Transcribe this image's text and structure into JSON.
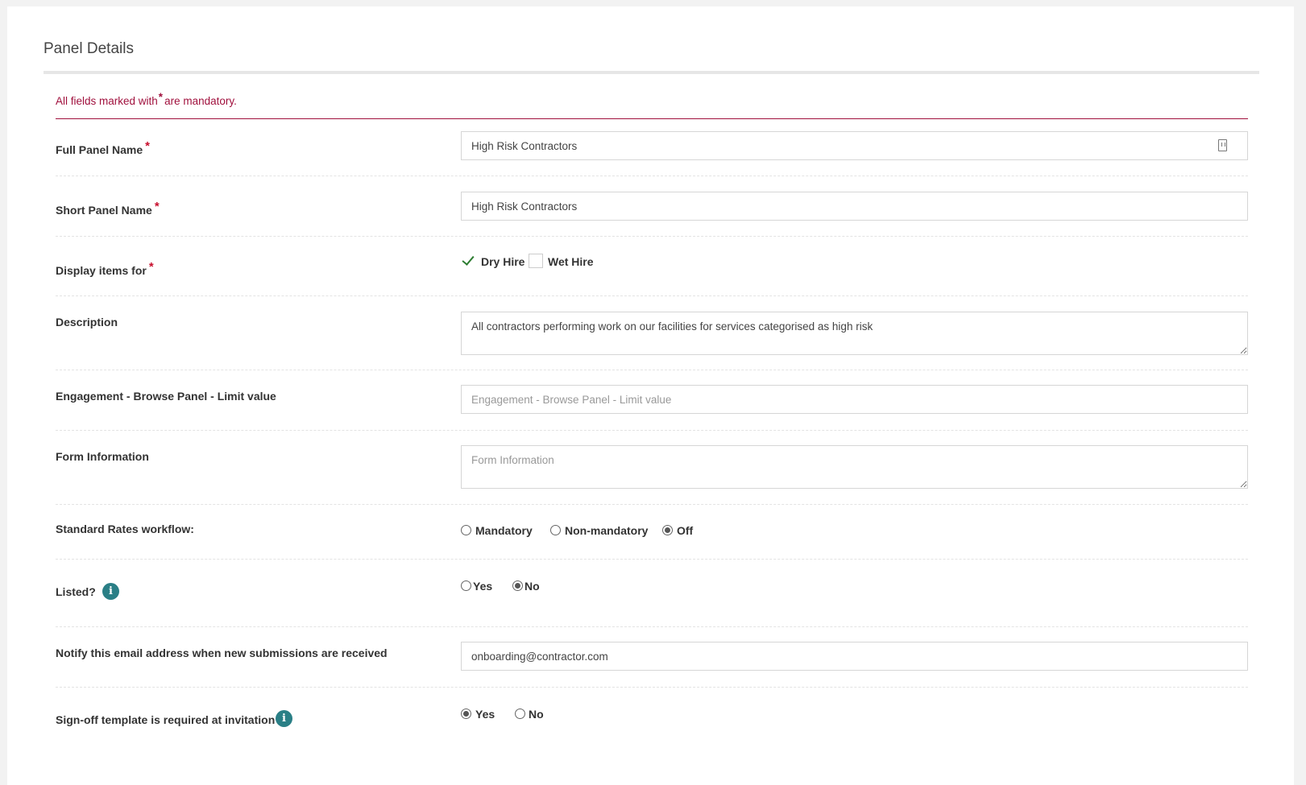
{
  "panel": {
    "title": "Panel Details",
    "notice_prefix": "All fields marked with",
    "notice_star": "*",
    "notice_suffix": "are mandatory."
  },
  "fields": {
    "full_name": {
      "label": "Full Panel Name",
      "required": "*",
      "value": "High Risk Contractors"
    },
    "short_name": {
      "label": "Short Panel Name",
      "required": "*",
      "value": "High Risk Contractors"
    },
    "display_items": {
      "label": "Display items for",
      "required": "*",
      "options": [
        {
          "label": "Dry Hire",
          "checked": true
        },
        {
          "label": "Wet Hire",
          "checked": false
        }
      ]
    },
    "description": {
      "label": "Description",
      "value": "All contractors performing work on our facilities for services categorised as high risk"
    },
    "engagement_limit": {
      "label": "Engagement - Browse Panel - Limit value",
      "value": "",
      "placeholder": "Engagement - Browse Panel - Limit value"
    },
    "form_information": {
      "label": "Form Information",
      "value": "",
      "placeholder": "Form Information"
    },
    "standard_rates": {
      "label": "Standard Rates workflow:",
      "options": [
        "Mandatory",
        "Non-mandatory",
        "Off"
      ],
      "selected": "Off"
    },
    "listed": {
      "label": "Listed?",
      "icon": "info-icon",
      "options": [
        "Yes",
        "No"
      ],
      "selected": "No"
    },
    "notify_email": {
      "label": "Notify this email address when new submissions are received",
      "value": "onboarding@contractor.com"
    },
    "signoff": {
      "label": "Sign-off template is required at invitation",
      "icon": "info-icon",
      "options": [
        "Yes",
        "No"
      ],
      "selected": "Yes"
    }
  },
  "colors": {
    "accent": "#a0103d",
    "required": "#c8102e",
    "info": "#2a7f86",
    "check": "#2e7d32"
  }
}
